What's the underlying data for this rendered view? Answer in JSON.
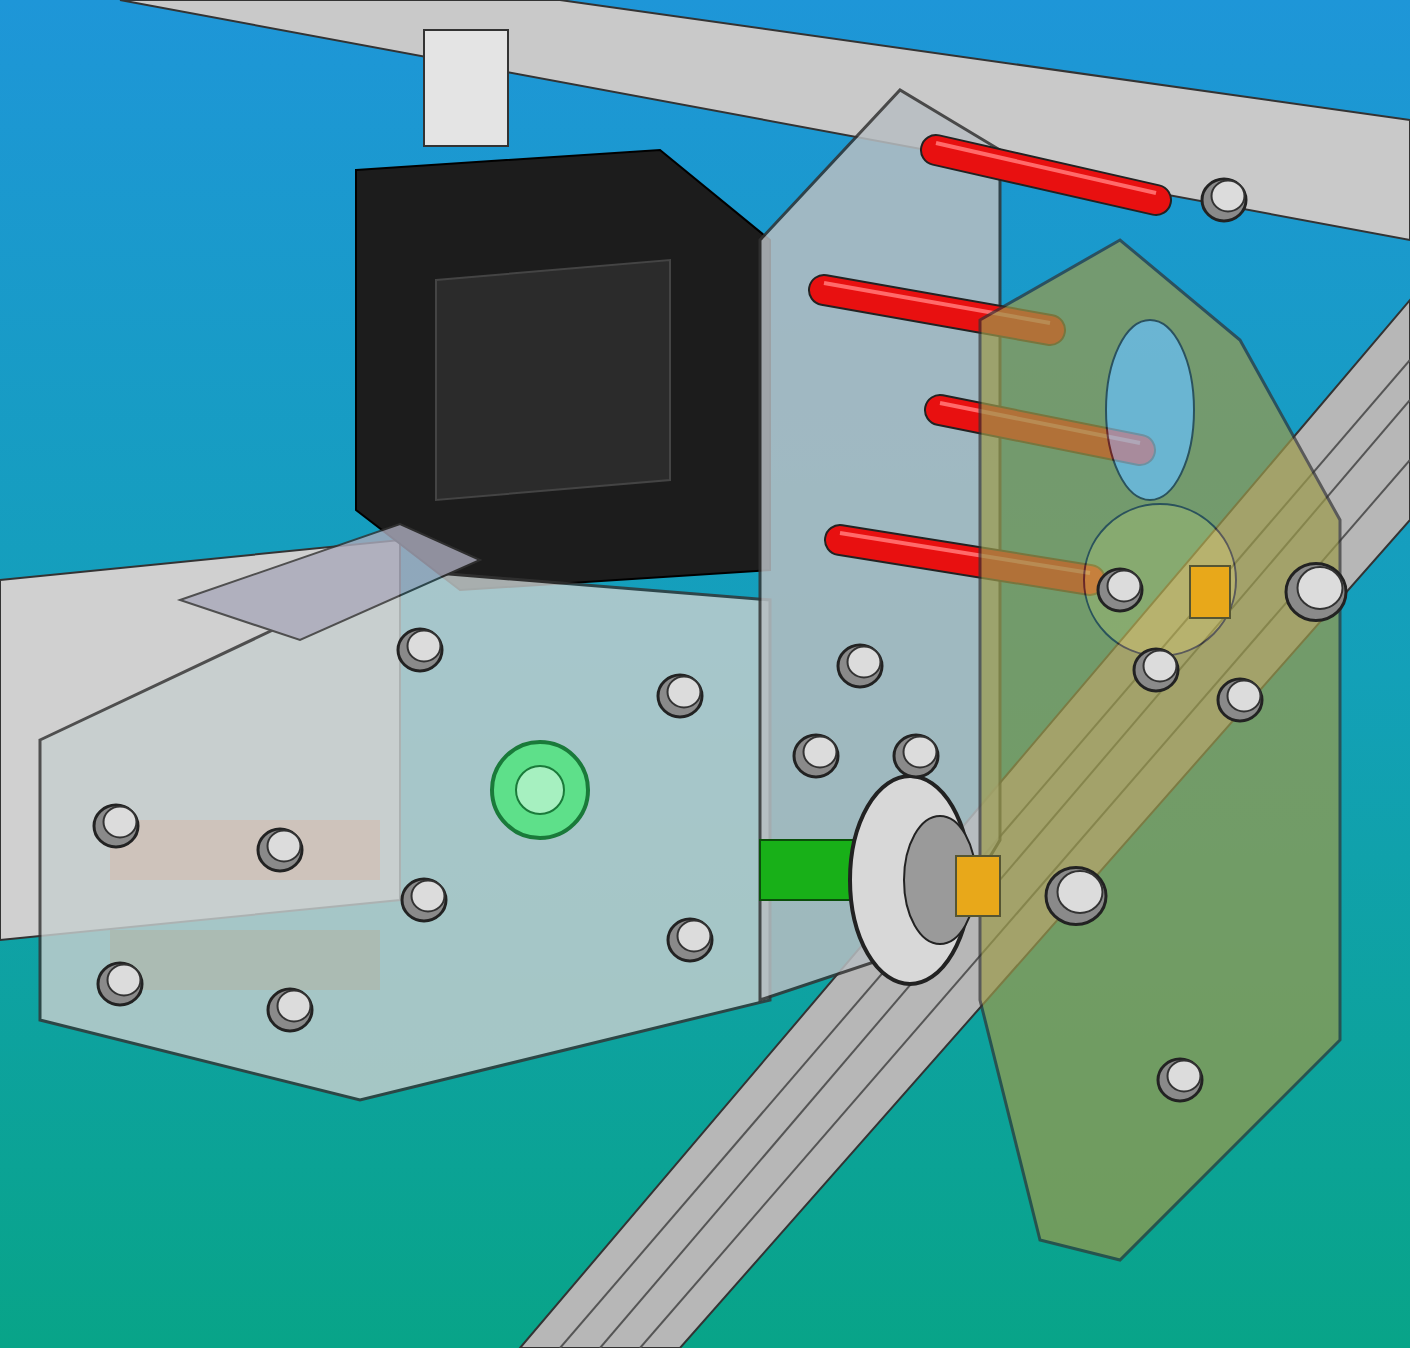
{
  "viewport": {
    "kind": "cad-render"
  }
}
